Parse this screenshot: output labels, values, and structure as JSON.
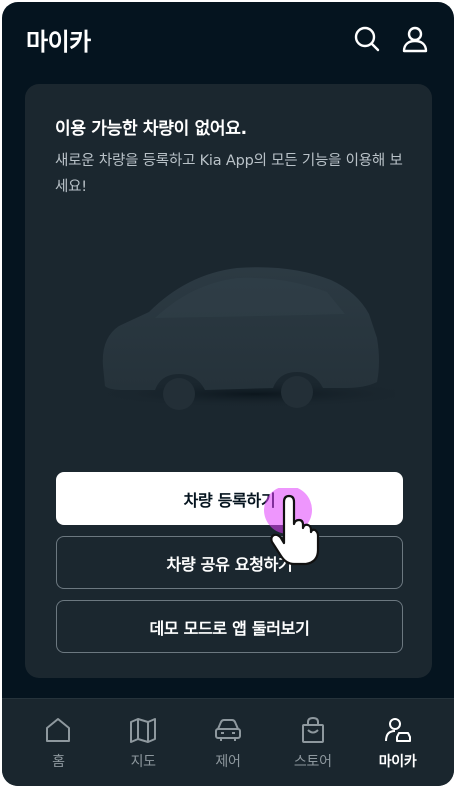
{
  "header": {
    "title": "마이카",
    "search_icon": "search-icon",
    "profile_icon": "user-icon"
  },
  "card": {
    "title": "이용 가능한 차량이 없어요.",
    "description": "새로운 차량을 등록하고 Kia App의 모든 기능을 이용해 보세요!",
    "illustration": "car-silhouette"
  },
  "buttons": {
    "register": "차량 등록하기",
    "share_request": "차량 공유 요청하기",
    "demo_mode": "데모 모드로 앱 둘러보기"
  },
  "bottom_nav": {
    "items": [
      {
        "label": "홈",
        "icon": "home-icon",
        "active": false
      },
      {
        "label": "지도",
        "icon": "map-icon",
        "active": false
      },
      {
        "label": "제어",
        "icon": "car-control-icon",
        "active": false
      },
      {
        "label": "스토어",
        "icon": "shopping-bag-icon",
        "active": false
      },
      {
        "label": "마이카",
        "icon": "mycar-user-icon",
        "active": true
      }
    ]
  },
  "colors": {
    "background": "#05141f",
    "card": "#1b272f",
    "nav": "#1a262e",
    "primary_button": "#ffffff",
    "touch_highlight": "#e040fb"
  }
}
